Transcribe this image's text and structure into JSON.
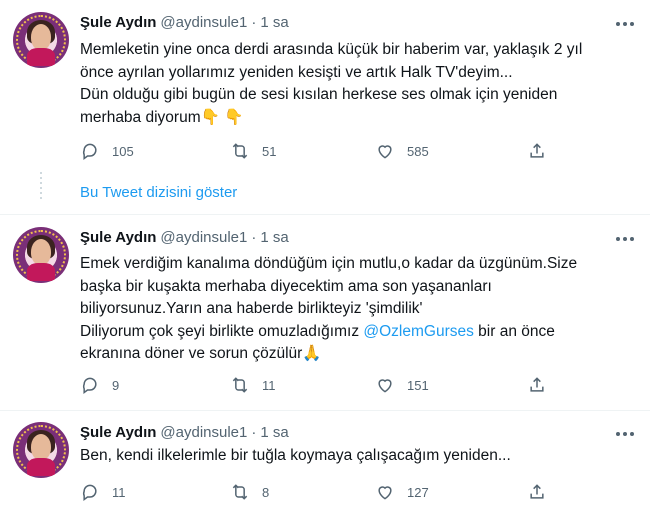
{
  "tweets": [
    {
      "name": "Şule Aydın",
      "handle": "@aydinsule1",
      "separator": "·",
      "time": "1 sa",
      "lines": [
        "Memleketin yine onca derdi arasında küçük bir haberim var, yaklaşık 2 yıl",
        "önce ayrılan yollarımız yeniden kesişti ve artık Halk TV'deyim...",
        "Dün olduğu gibi bugün de sesi kısılan herkese ses olmak için yeniden",
        "merhaba diyorum"
      ],
      "line4_emoji": "👇 👇",
      "replies": "105",
      "retweets": "51",
      "likes": "585"
    },
    {
      "name": "Şule Aydın",
      "handle": "@aydinsule1",
      "separator": "·",
      "time": "1 sa",
      "lines": [
        "Emek verdiğim kanalıma döndüğüm için mutlu,o kadar da üzgünüm.Size",
        "başka bir kuşakta merhaba diyecektim ama son yaşananları",
        "biliyorsunuz.Yarın ana haberde birlikteyiz 'şimdilik'"
      ],
      "line4_pre": "Diliyorum çok şeyi birlikte omuzladığımız ",
      "mention": "@OzlemGurses",
      "line4_post": " bir an önce",
      "line5": "ekranına döner ve sorun çözülür",
      "line5_emoji": "🙏",
      "replies": "9",
      "retweets": "11",
      "likes": "151"
    },
    {
      "name": "Şule Aydın",
      "handle": "@aydinsule1",
      "separator": "·",
      "time": "1 sa",
      "lines": [
        "Ben, kendi ilkelerimle bir tuğla koymaya çalışacağım yeniden..."
      ],
      "replies": "11",
      "retweets": "8",
      "likes": "127"
    }
  ],
  "show_thread_label": "Bu Tweet dizisini göster",
  "colors": {
    "accent": "#1d9bf0",
    "secondary_text": "#536471",
    "primary_text": "#0f1419"
  },
  "icons": [
    "reply-icon",
    "retweet-icon",
    "like-icon",
    "share-icon",
    "more-icon"
  ]
}
